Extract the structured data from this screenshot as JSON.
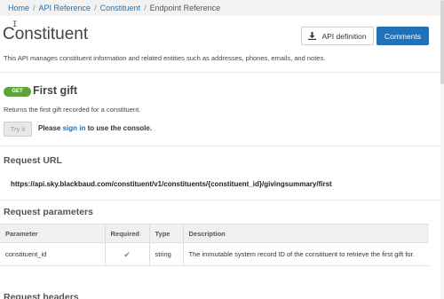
{
  "breadcrumb": {
    "items": [
      "Home",
      "API Reference",
      "Constituent"
    ],
    "current": "Endpoint Reference",
    "separator": "/"
  },
  "page": {
    "title": "Constituent",
    "description": "This API manages constituent information and related entities such as addresses, phones, emails, and notes."
  },
  "header_buttons": {
    "api_definition": "API definition",
    "comments": "Comments"
  },
  "operation": {
    "method": "GET",
    "title": "First gift",
    "description": "Returns the first gift recorded for a constituent.",
    "try_it": "Try it",
    "signin_before": "Please",
    "signin_link": "sign in",
    "signin_after": "to use the console."
  },
  "sections": {
    "request_url": "Request URL",
    "request_parameters": "Request parameters",
    "request_headers": "Request headers"
  },
  "request_url": "https://api.sky.blackbaud.com/constituent/v1/constituents/{constituent_id}/givingsummary/first",
  "params_table": {
    "headers": [
      "Parameter",
      "Required",
      "Type",
      "Description"
    ],
    "rows": [
      {
        "parameter": "constituent_id",
        "required": true,
        "type": "string",
        "description": "The immutable system record ID of the constituent to retrieve the first gift for."
      }
    ]
  },
  "colors": {
    "accent": "#1f72b8",
    "get_badge": "#5ba33b",
    "check": "#5ba33b"
  },
  "icons": {
    "download": "download-icon",
    "check": "checkmark-icon",
    "cursor": "text-cursor-icon"
  }
}
